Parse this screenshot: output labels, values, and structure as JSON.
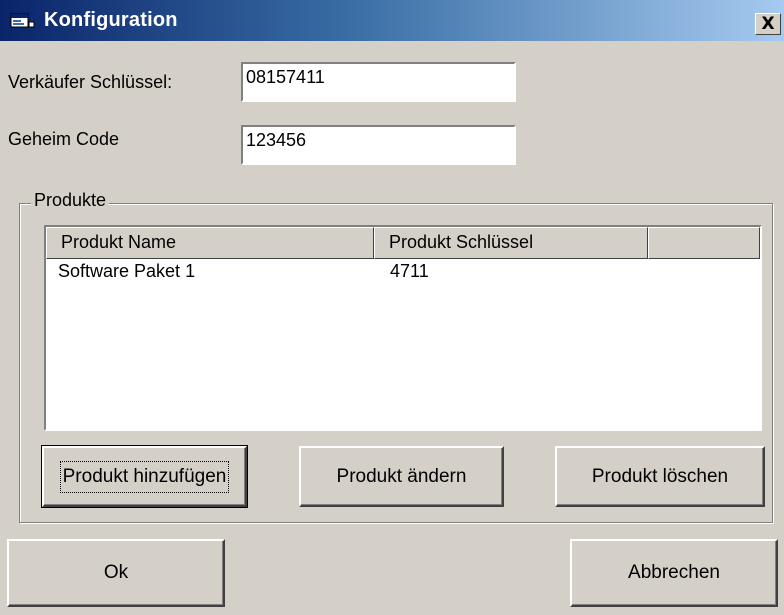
{
  "window": {
    "title": "Konfiguration",
    "icon": "window-app-icon",
    "close_label": "X"
  },
  "form": {
    "seller_key_label": "Verkäufer Schlüssel:",
    "seller_key_value": "08157411",
    "secret_code_label": "Geheim Code",
    "secret_code_value": "123456"
  },
  "products": {
    "group_title": "Produkte",
    "columns": [
      "Produkt Name",
      "Produkt Schlüssel",
      ""
    ],
    "rows": [
      {
        "name": "Software Paket 1",
        "key": "4711"
      }
    ],
    "add_button": "Produkt hinzufügen",
    "edit_button": "Produkt ändern",
    "delete_button": "Produkt löschen"
  },
  "footer": {
    "ok_button": "Ok",
    "cancel_button": "Abbrechen"
  },
  "colors": {
    "titlebar_start": "#0a246a",
    "titlebar_end": "#a6caf0",
    "face": "#d4d0c8"
  }
}
